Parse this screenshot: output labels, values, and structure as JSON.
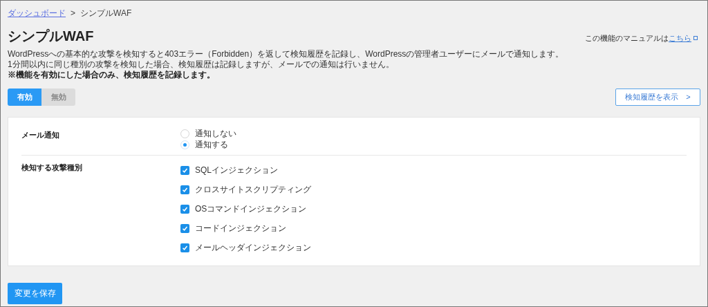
{
  "breadcrumb": {
    "link": "ダッシュボード",
    "separator": ">",
    "current": "シンプルWAF"
  },
  "title": "シンプルWAF",
  "manual": {
    "text": "この機能のマニュアルは",
    "link": "こちら"
  },
  "description": [
    "WordPressへの基本的な攻撃を検知すると403エラー（Forbidden）を返して検知履歴を記録し、WordPressの管理者ユーザーにメールで通知します。",
    "1分間以内に同じ種別の攻撃を検知した場合、検知履歴は記録しますが、メールでの通知は行いません。"
  ],
  "note": "※機能を有効にした場合のみ、検知履歴を記録します。",
  "toggle": [
    {
      "label": "有効",
      "selected": true
    },
    {
      "label": "無効",
      "selected": false
    }
  ],
  "history_button": "検知履歴を表示　>",
  "sections": [
    {
      "label": "メール通知",
      "kind": "radio",
      "options": [
        {
          "label": "通知しない",
          "selected": false
        },
        {
          "label": "通知する",
          "selected": true
        }
      ]
    },
    {
      "label": "検知する攻撃種別",
      "kind": "checkbox",
      "options": [
        {
          "label": "SQLインジェクション",
          "checked": true
        },
        {
          "label": "クロスサイトスクリプティング",
          "checked": true
        },
        {
          "label": "OSコマンドインジェクション",
          "checked": true
        },
        {
          "label": "コードインジェクション",
          "checked": true
        },
        {
          "label": "メールヘッダインジェクション",
          "checked": true
        }
      ]
    }
  ],
  "save_button": "変更を保存"
}
